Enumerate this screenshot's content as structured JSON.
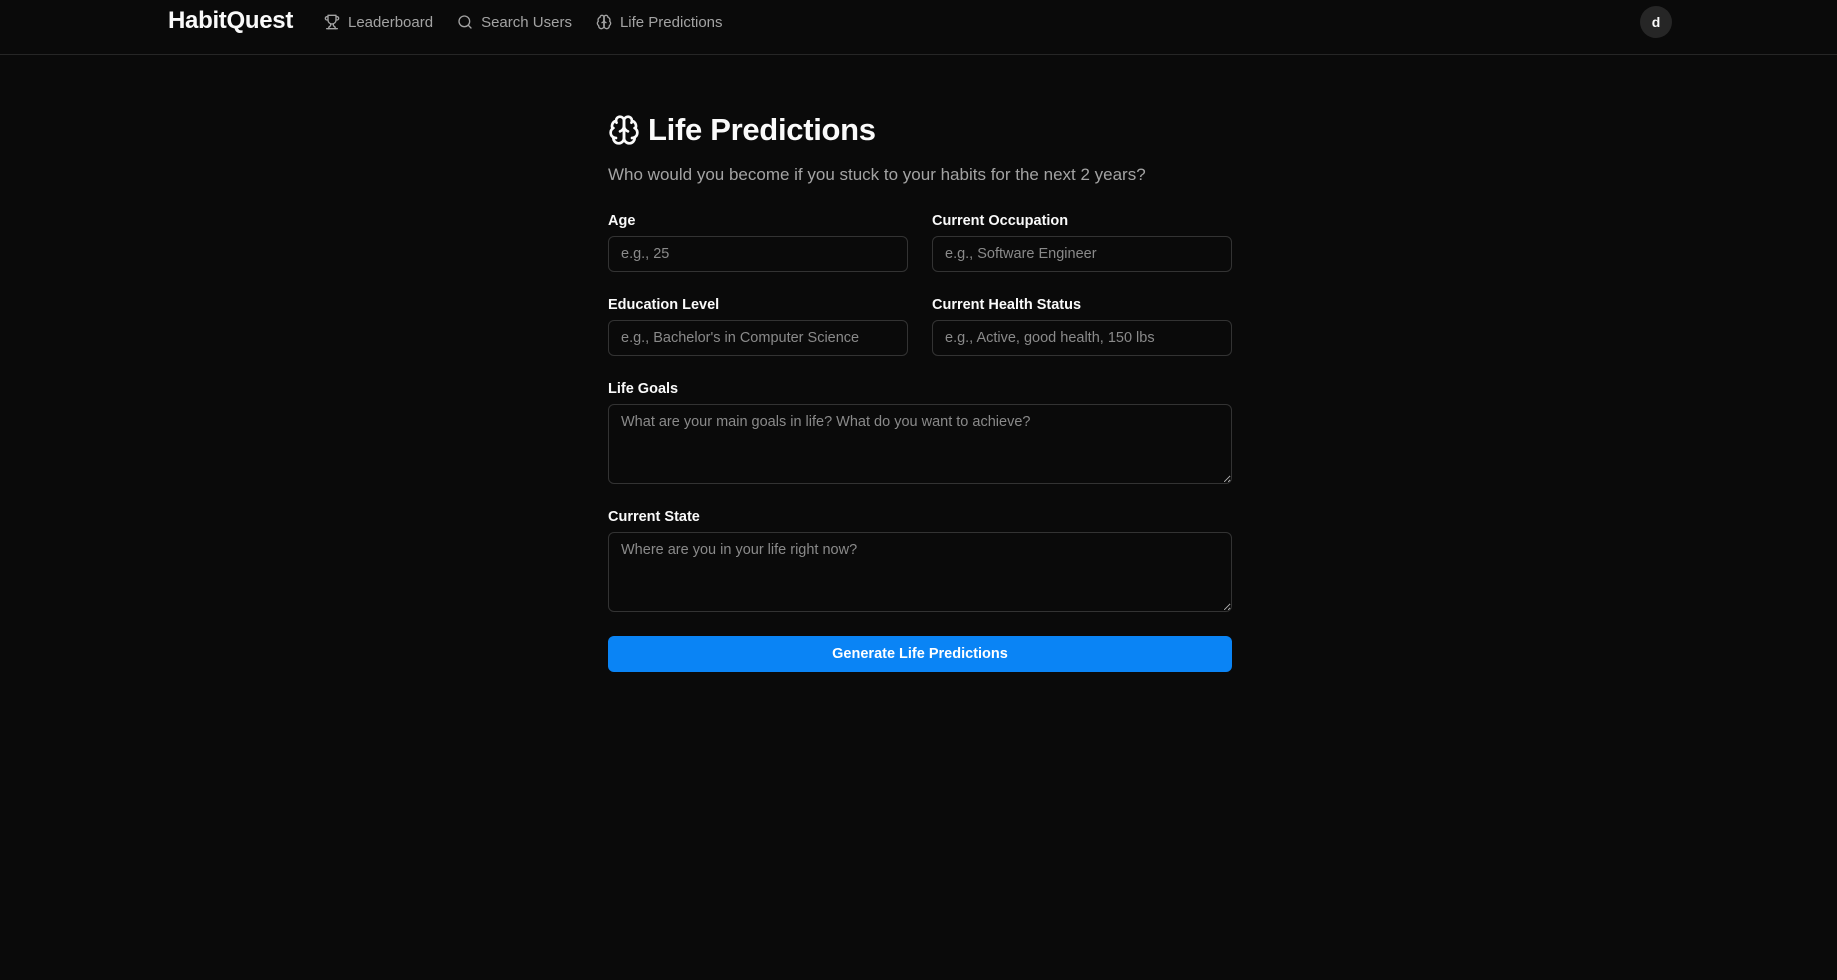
{
  "header": {
    "brand": "HabitQuest",
    "nav": [
      {
        "label": "Leaderboard",
        "icon": "trophy-icon"
      },
      {
        "label": "Search Users",
        "icon": "search-icon"
      },
      {
        "label": "Life Predictions",
        "icon": "brain-icon"
      }
    ],
    "avatar_initial": "d"
  },
  "main": {
    "title": "Life Predictions",
    "title_icon": "brain-icon",
    "subtitle": "Who would you become if you stuck to your habits for the next 2 years?",
    "fields": {
      "age": {
        "label": "Age",
        "placeholder": "e.g., 25",
        "value": ""
      },
      "occupation": {
        "label": "Current Occupation",
        "placeholder": "e.g., Software Engineer",
        "value": ""
      },
      "education": {
        "label": "Education Level",
        "placeholder": "e.g., Bachelor's in Computer Science",
        "value": ""
      },
      "health": {
        "label": "Current Health Status",
        "placeholder": "e.g., Active, good health, 150 lbs",
        "value": ""
      },
      "goals": {
        "label": "Life Goals",
        "placeholder": "What are your main goals in life? What do you want to achieve?",
        "value": ""
      },
      "state": {
        "label": "Current State",
        "placeholder": "Where are you in your life right now?",
        "value": ""
      }
    },
    "submit_label": "Generate Life Predictions"
  },
  "colors": {
    "background": "#0a0a0a",
    "border": "#333333",
    "muted_text": "#a3a3a3",
    "accent": "#0a84f5"
  }
}
